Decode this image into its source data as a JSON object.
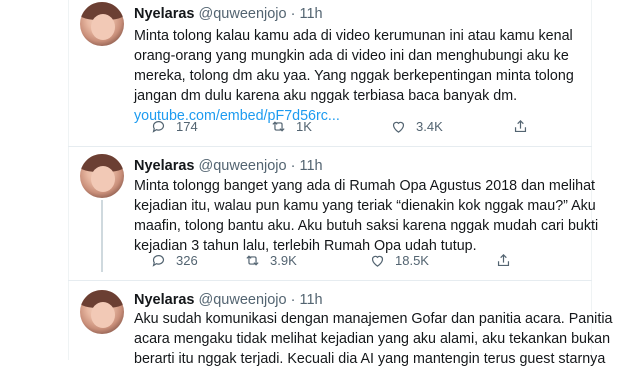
{
  "tweets": [
    {
      "name": "Nyelaras",
      "handle": "@quweenjojo",
      "sep": "·",
      "time": "11h",
      "lines": [
        "Minta tolong kalau kamu ada di video kerumunan ini atau kamu kenal",
        "orang-orang yang mungkin ada di video ini dan menghubungi aku ke",
        "mereka, tolong dm aku yaa. Yang nggak berkepentingan minta tolong",
        "jangan dm dulu karena aku nggak terbiasa baca banyak dm."
      ],
      "link": "youtube.com/embed/pF7d56rc...",
      "replies": "174",
      "retweets": "1K",
      "likes": "3.4K"
    },
    {
      "name": "Nyelaras",
      "handle": "@quweenjojo",
      "sep": "·",
      "time": "11h",
      "lines": [
        "Minta tolongg banget yang ada di Rumah Opa Agustus 2018 dan melihat",
        "kejadian itu, walau pun kamu yang teriak “dienakin kok nggak mau?” Aku",
        "maafin, tolong bantu aku. Aku butuh saksi karena nggak mudah cari bukti",
        "kejadian 3 tahun lalu, terlebih Rumah Opa udah tutup."
      ],
      "replies": "326",
      "retweets": "3.9K",
      "likes": "18.5K"
    },
    {
      "name": "Nyelaras",
      "handle": "@quweenjojo",
      "sep": "·",
      "time": "11h",
      "lines": [
        "Aku sudah komunikasi dengan manajemen Gofar dan panitia acara. Panitia",
        "acara mengaku tidak melihat kejadian yang aku alami, aku tekankan bukan",
        "berarti itu nggak terjadi. Kecuali dia AI yang mantengin terus guest starnya"
      ]
    }
  ],
  "icons": [
    "reply-icon",
    "retweet-icon",
    "like-icon",
    "share-icon"
  ],
  "colors": {
    "link": "#1d9bf0",
    "muted": "#536471"
  }
}
